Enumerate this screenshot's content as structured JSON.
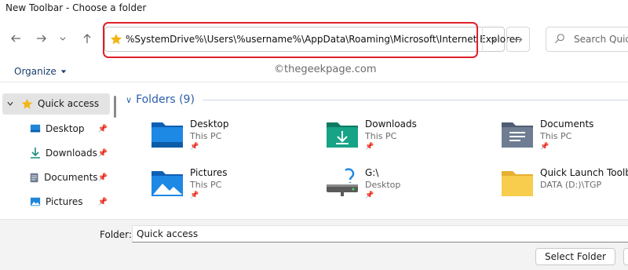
{
  "window": {
    "title": "New Toolbar - Choose a folder"
  },
  "nav": {
    "back_icon": "arrow-left-icon",
    "forward_icon": "arrow-right-icon",
    "recent_icon": "chevron-down-icon",
    "up_icon": "arrow-up-icon"
  },
  "address": {
    "path": "%SystemDrive%\\Users\\%username%\\AppData\\Roaming\\Microsoft\\Internet Explorer",
    "highlight_color": "#e0202a"
  },
  "search": {
    "placeholder": "Search Quick"
  },
  "toolbar": {
    "organize_label": "Organize"
  },
  "watermark": "©thegeekpage.com",
  "sidebar": {
    "items": [
      {
        "label": "Quick access",
        "icon": "star-icon",
        "selected": true
      },
      {
        "label": "Desktop",
        "icon": "desktop-icon",
        "pinned": true
      },
      {
        "label": "Downloads",
        "icon": "download-icon",
        "pinned": true
      },
      {
        "label": "Documents",
        "icon": "document-icon",
        "pinned": true
      },
      {
        "label": "Pictures",
        "icon": "pictures-icon",
        "pinned": true
      }
    ]
  },
  "main": {
    "group_title": "Folders (9)",
    "folders": [
      {
        "name": "Desktop",
        "location": "This PC",
        "icon": "desktop-folder-icon"
      },
      {
        "name": "Downloads",
        "location": "This PC",
        "icon": "downloads-folder-icon"
      },
      {
        "name": "Documents",
        "location": "This PC",
        "icon": "documents-folder-icon"
      },
      {
        "name": "Pictures",
        "location": "This PC",
        "icon": "pictures-folder-icon"
      },
      {
        "name": "G:\\",
        "location": "Desktop",
        "icon": "network-drive-icon"
      },
      {
        "name": "Quick Launch Toolbar",
        "location": "DATA (D:)\\TGP",
        "icon": "folder-icon"
      }
    ]
  },
  "footer": {
    "folder_label": "Folder:",
    "folder_value": "Quick access",
    "select_label": "Select Folder"
  },
  "colors": {
    "accent": "#0a5fc4",
    "star": "#f2b517",
    "folder": "#f8cd4e"
  }
}
